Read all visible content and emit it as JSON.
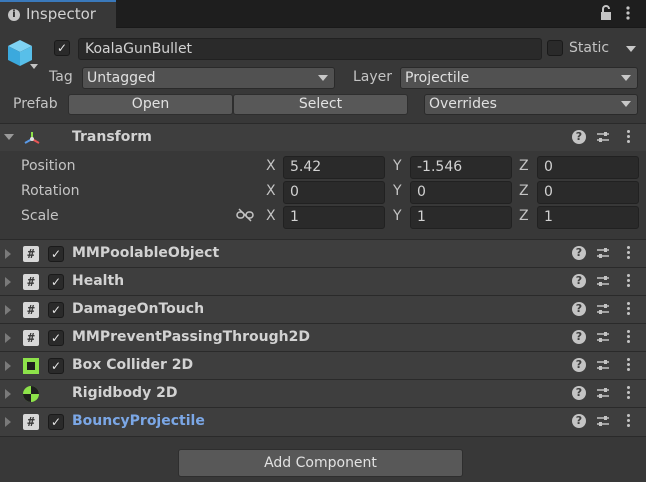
{
  "tab": {
    "label": "Inspector"
  },
  "gameobject": {
    "active": true,
    "name": "KoalaGunBullet",
    "static_label": "Static",
    "tag_label": "Tag",
    "tag_value": "Untagged",
    "layer_label": "Layer",
    "layer_value": "Projectile",
    "prefab_label": "Prefab",
    "open_label": "Open",
    "select_label": "Select",
    "overrides_label": "Overrides"
  },
  "transform": {
    "title": "Transform",
    "position_label": "Position",
    "rotation_label": "Rotation",
    "scale_label": "Scale",
    "axis_x": "X",
    "axis_y": "Y",
    "axis_z": "Z",
    "position": [
      "5.42",
      "-1.546",
      "0"
    ],
    "rotation": [
      "0",
      "0",
      "0"
    ],
    "scale": [
      "1",
      "1",
      "1"
    ]
  },
  "components": [
    {
      "name": "MMPoolableObject",
      "icon": "script-icon",
      "checked": true
    },
    {
      "name": "Health",
      "icon": "script-icon",
      "checked": true
    },
    {
      "name": "DamageOnTouch",
      "icon": "script-icon",
      "checked": true
    },
    {
      "name": "MMPreventPassingThrough2D",
      "icon": "script-icon",
      "checked": true
    },
    {
      "name": "Box Collider 2D",
      "icon": "box-collider-icon",
      "checked": true
    },
    {
      "name": "Rigidbody 2D",
      "icon": "rigidbody-icon",
      "checked": false
    },
    {
      "name": "BouncyProjectile",
      "icon": "script-icon",
      "checked": true,
      "highlight": true
    }
  ],
  "add_component_label": "Add Component",
  "colors": {
    "accent": "#3a79bb",
    "link": "#7ba7e6",
    "collider_green": "#8de24a",
    "panel": "#383838"
  }
}
